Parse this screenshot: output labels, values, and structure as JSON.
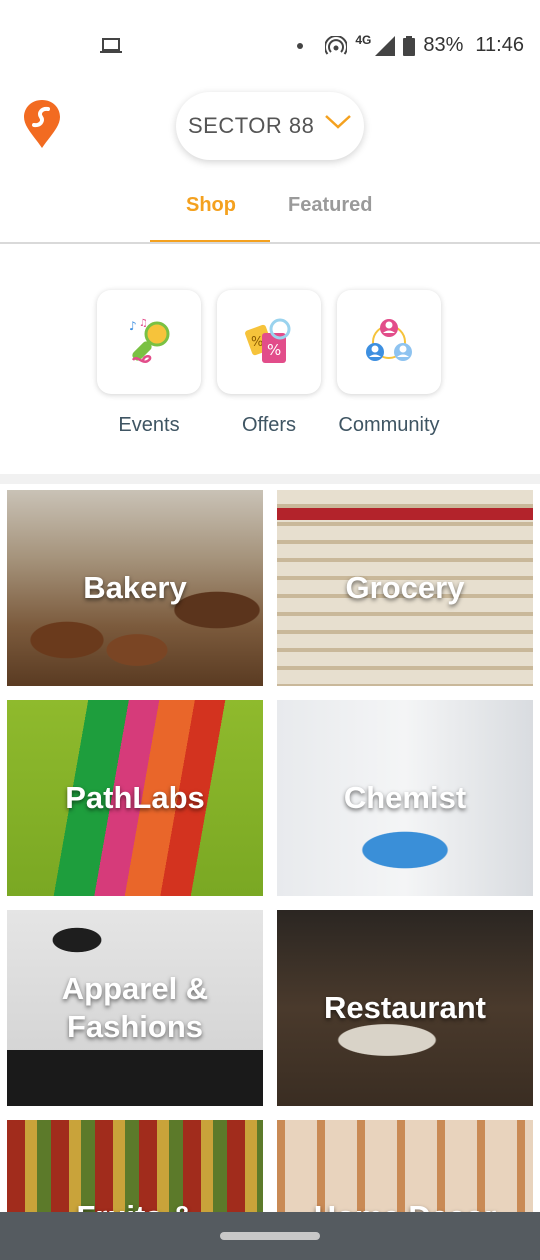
{
  "status_bar": {
    "battery": "83%",
    "time": "11:46",
    "network": "4G"
  },
  "header": {
    "location": "SECTOR 88",
    "accent_color": "#F4A11F"
  },
  "tabs": [
    {
      "label": "Shop",
      "active": true
    },
    {
      "label": "Featured",
      "active": false
    }
  ],
  "quick_actions": [
    {
      "label": "Events",
      "icon": "microphone-icon"
    },
    {
      "label": "Offers",
      "icon": "discount-tag-icon"
    },
    {
      "label": "Community",
      "icon": "community-icon"
    }
  ],
  "categories": [
    {
      "label": "Bakery"
    },
    {
      "label": "Grocery"
    },
    {
      "label": "PathLabs"
    },
    {
      "label": "Chemist"
    },
    {
      "label": "Apparel & Fashions"
    },
    {
      "label": "Restaurant"
    },
    {
      "label": "Fruits &"
    },
    {
      "label": "Home Decor"
    }
  ]
}
